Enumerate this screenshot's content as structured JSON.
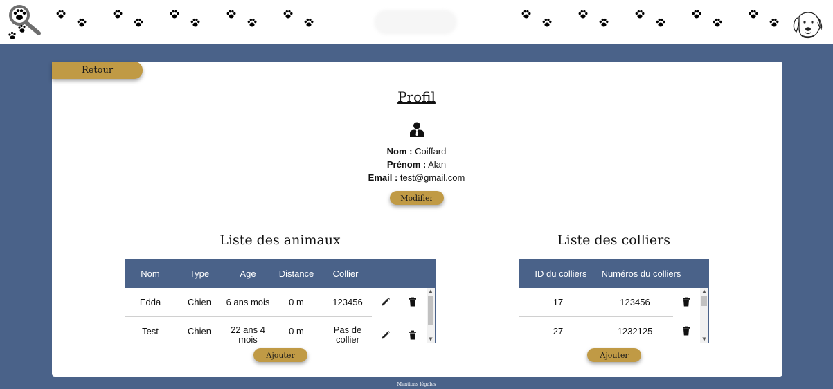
{
  "header": {
    "logo_left_icon": "paw-magnifier-icon",
    "logo_right_icon": "dog-head-icon",
    "decoration_icon": "paw-icon"
  },
  "back_button": {
    "label": "Retour"
  },
  "profile": {
    "title": "Profil",
    "icon": "user-icon",
    "fields": [
      {
        "label": "Nom :",
        "value": "Coiffard"
      },
      {
        "label": "Prénom :",
        "value": "Alan"
      },
      {
        "label": "Email :",
        "value": "test@gmail.com"
      }
    ],
    "edit_label": "Modifier"
  },
  "animals": {
    "title": "Liste des animaux",
    "columns": [
      "Nom",
      "Type",
      "Age",
      "Distance",
      "Collier"
    ],
    "rows": [
      {
        "nom": "Edda",
        "type": "Chien",
        "age": "6 ans mois",
        "distance": "0 m",
        "collier": "123456"
      },
      {
        "nom": "Test",
        "type": "Chien",
        "age": "22 ans 4 mois",
        "distance": "0 m",
        "collier": "Pas de collier"
      }
    ],
    "add_label": "Ajouter"
  },
  "collars": {
    "title": "Liste des colliers",
    "columns": [
      "ID du colliers",
      "Numéros du colliers"
    ],
    "rows": [
      {
        "id": "17",
        "numero": "123456"
      },
      {
        "id": "27",
        "numero": "1232125"
      }
    ],
    "add_label": "Ajouter"
  },
  "footer": {
    "legal_label": "Mentions légales"
  },
  "colors": {
    "background": "#4a6289",
    "accent_gold": "#c09a45",
    "table_header": "#4a6289"
  }
}
